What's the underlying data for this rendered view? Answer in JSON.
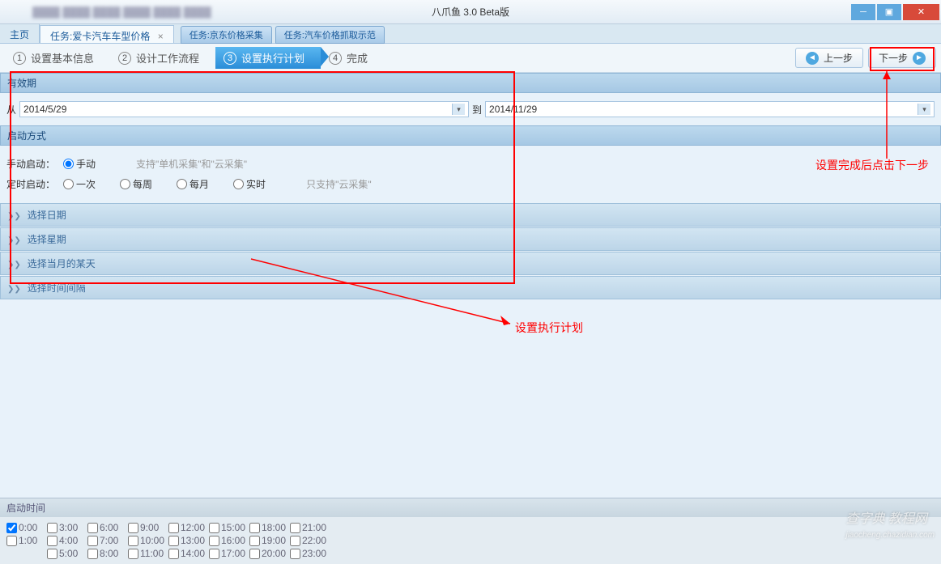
{
  "titlebar": {
    "app_title": "八爪鱼 3.0 Beta版",
    "blur_text": "..."
  },
  "tabs": {
    "home": "主页",
    "active": "任务:爱卡汽车车型价格",
    "others": [
      "任务:京东价格采集",
      "任务:汽车价格抓取示范"
    ]
  },
  "wizard": {
    "step1": "设置基本信息",
    "step2": "设计工作流程",
    "step3": "设置执行计划",
    "step4": "完成",
    "prev": "上一步",
    "next": "下一步"
  },
  "validity": {
    "header": "有效期",
    "from_label": "从",
    "from_value": "2014/5/29",
    "to_label": "到",
    "to_value": "2014/11/29"
  },
  "startup": {
    "header": "启动方式",
    "manual_label": "手动启动：",
    "manual_opt": "手动",
    "manual_hint": "支持\"单机采集\"和\"云采集\"",
    "timed_label": "定时启动：",
    "once": "一次",
    "weekly": "每周",
    "monthly": "每月",
    "realtime": "实时",
    "timed_hint": "只支持\"云采集\""
  },
  "accordions": {
    "date": "选择日期",
    "week": "选择星期",
    "monthday": "选择当月的某天",
    "interval": "选择时间间隔"
  },
  "bottom": {
    "header": "启动时间",
    "row1": [
      "0:00",
      "3:00",
      "6:00",
      "9:00",
      "12:00",
      "15:00",
      "18:00",
      "21:00"
    ],
    "row2": [
      "1:00",
      "4:00",
      "7:00",
      "10:00",
      "13:00",
      "16:00",
      "19:00",
      "22:00"
    ],
    "row3": [
      "5:00",
      "8:00",
      "11:00",
      "14:00",
      "17:00",
      "20:00",
      "23:00"
    ]
  },
  "annotations": {
    "plan": "设置执行计划",
    "next": "设置完成后点击下一步"
  },
  "watermark": {
    "main": "查字典 教程网",
    "sub": "jiaocheng.chazidian.com"
  }
}
